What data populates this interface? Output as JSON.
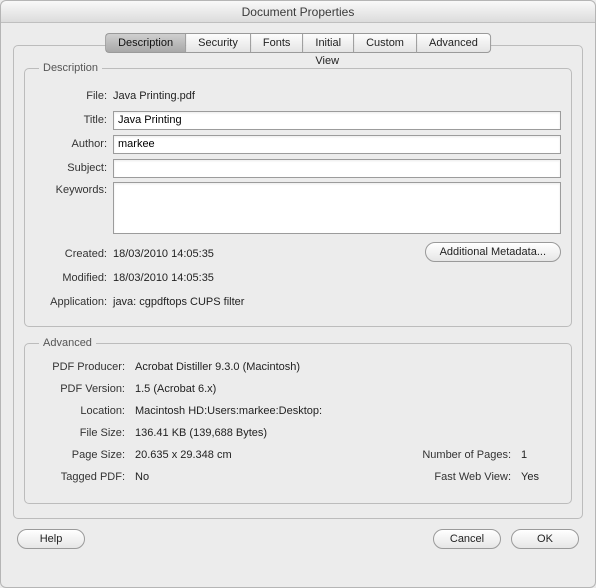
{
  "window": {
    "title": "Document Properties"
  },
  "tabs": {
    "description": "Description",
    "security": "Security",
    "fonts": "Fonts",
    "initial_view": "Initial View",
    "custom": "Custom",
    "advanced": "Advanced"
  },
  "description_group": {
    "legend": "Description",
    "labels": {
      "file": "File:",
      "title": "Title:",
      "author": "Author:",
      "subject": "Subject:",
      "keywords": "Keywords:",
      "created": "Created:",
      "modified": "Modified:",
      "application": "Application:"
    },
    "file": "Java Printing.pdf",
    "title": "Java Printing",
    "author": "markee",
    "subject": "",
    "keywords": "",
    "created": "18/03/2010 14:05:35",
    "modified": "18/03/2010 14:05:35",
    "application": "java: cgpdftops CUPS filter",
    "additional_metadata_btn": "Additional Metadata..."
  },
  "advanced_group": {
    "legend": "Advanced",
    "labels": {
      "producer": "PDF Producer:",
      "version": "PDF Version:",
      "location": "Location:",
      "filesize": "File Size:",
      "pagesize": "Page Size:",
      "numpages": "Number of Pages:",
      "tagged": "Tagged PDF:",
      "fastweb": "Fast Web View:"
    },
    "producer": "Acrobat Distiller 9.3.0 (Macintosh)",
    "version": "1.5 (Acrobat 6.x)",
    "location": "Macintosh HD:Users:markee:Desktop:",
    "filesize": "136.41 KB (139,688 Bytes)",
    "pagesize": "20.635 x 29.348 cm",
    "numpages": "1",
    "tagged": "No",
    "fastweb": "Yes"
  },
  "footer": {
    "help": "Help",
    "cancel": "Cancel",
    "ok": "OK"
  }
}
